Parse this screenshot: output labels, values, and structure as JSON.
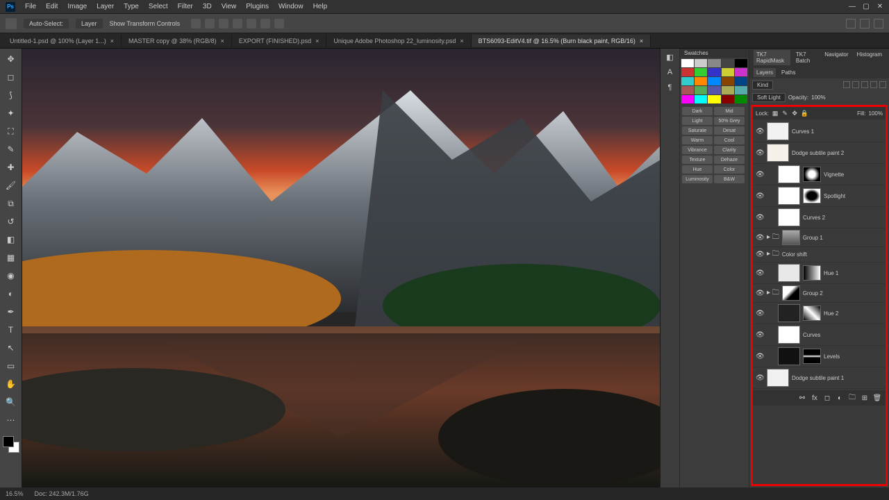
{
  "app": {
    "logo": "Ps"
  },
  "menu": [
    "File",
    "Edit",
    "Image",
    "Layer",
    "Type",
    "Select",
    "Filter",
    "3D",
    "View",
    "Plugins",
    "Window",
    "Help"
  ],
  "options": {
    "auto_select": "Auto-Select:",
    "layer": "Layer",
    "transform": "Show Transform Controls"
  },
  "tabs": [
    {
      "label": "Untitled-1.psd @ 100% (Layer 1...)",
      "active": false
    },
    {
      "label": "MASTER copy @ 38% (RGB/8)",
      "active": false
    },
    {
      "label": "EXPORT (FINISHED).psd",
      "active": false
    },
    {
      "label": "Unique Adobe Photoshop 22_luminosity.psd",
      "active": false
    },
    {
      "label": "BTS6093-EditV4.tif @ 16.5% (Burn black paint, RGB/16)",
      "active": true
    }
  ],
  "swatches_tab": "Swatches",
  "action_buttons": [
    "Dark",
    "Mid",
    "Light",
    "50% Grey",
    "Saturate",
    "Desat",
    "Warm",
    "Cool",
    "Vibrance",
    "Clarity",
    "Texture",
    "Dehaze",
    "Hue",
    "Color",
    "Luminosity",
    "B&W"
  ],
  "panel_tabs": [
    "TK7 RapidMask",
    "TK7 Batch",
    "Navigator",
    "Histogram"
  ],
  "layers": {
    "title": "Layers",
    "kind": "Kind",
    "blend": "Soft Light",
    "opacity": "Opacity:",
    "opacity_val": "100%",
    "lock": "Lock:",
    "fill": "Fill:",
    "fill_val": "100%",
    "items": [
      {
        "name": "Curves 1",
        "eye": true,
        "thumb": "#f2f2f2",
        "mask": null,
        "indent": 0
      },
      {
        "name": "Dodge subtile paint 2",
        "eye": true,
        "thumb": "#f5f0ea",
        "mask": null,
        "indent": 0
      },
      {
        "name": "Vignette",
        "eye": true,
        "thumb": "#fff",
        "mask": "radial",
        "indent": 1
      },
      {
        "name": "Spotlight",
        "eye": true,
        "thumb": "#fff",
        "mask": "oval",
        "indent": 1
      },
      {
        "name": "Curves 2",
        "eye": true,
        "thumb": "#fff",
        "mask": null,
        "indent": 1
      },
      {
        "name": "Group 1",
        "eye": true,
        "folder": true,
        "thumb": "scene",
        "indent": 0
      },
      {
        "name": "Color shift",
        "eye": true,
        "folder": true,
        "indent": 0
      },
      {
        "name": "Hue 1",
        "eye": true,
        "thumb": "#e8e8e8",
        "mask": "bw1",
        "indent": 1
      },
      {
        "name": "Group 2",
        "eye": true,
        "folder": true,
        "thumb": "bw2",
        "indent": 0
      },
      {
        "name": "Hue 2",
        "eye": true,
        "thumb": "#222",
        "mask": "bw3",
        "indent": 1
      },
      {
        "name": "Curves",
        "eye": true,
        "thumb": "#fff",
        "mask": null,
        "indent": 1
      },
      {
        "name": "Levels",
        "eye": true,
        "thumb": "#111",
        "mask": "bw4",
        "indent": 1
      },
      {
        "name": "Dodge subtile paint 1",
        "eye": true,
        "thumb": "#f0f0f0",
        "mask": null,
        "indent": 0
      }
    ]
  },
  "status": {
    "zoom": "16.5%",
    "doc": "Doc: 242.3M/1.76G"
  }
}
